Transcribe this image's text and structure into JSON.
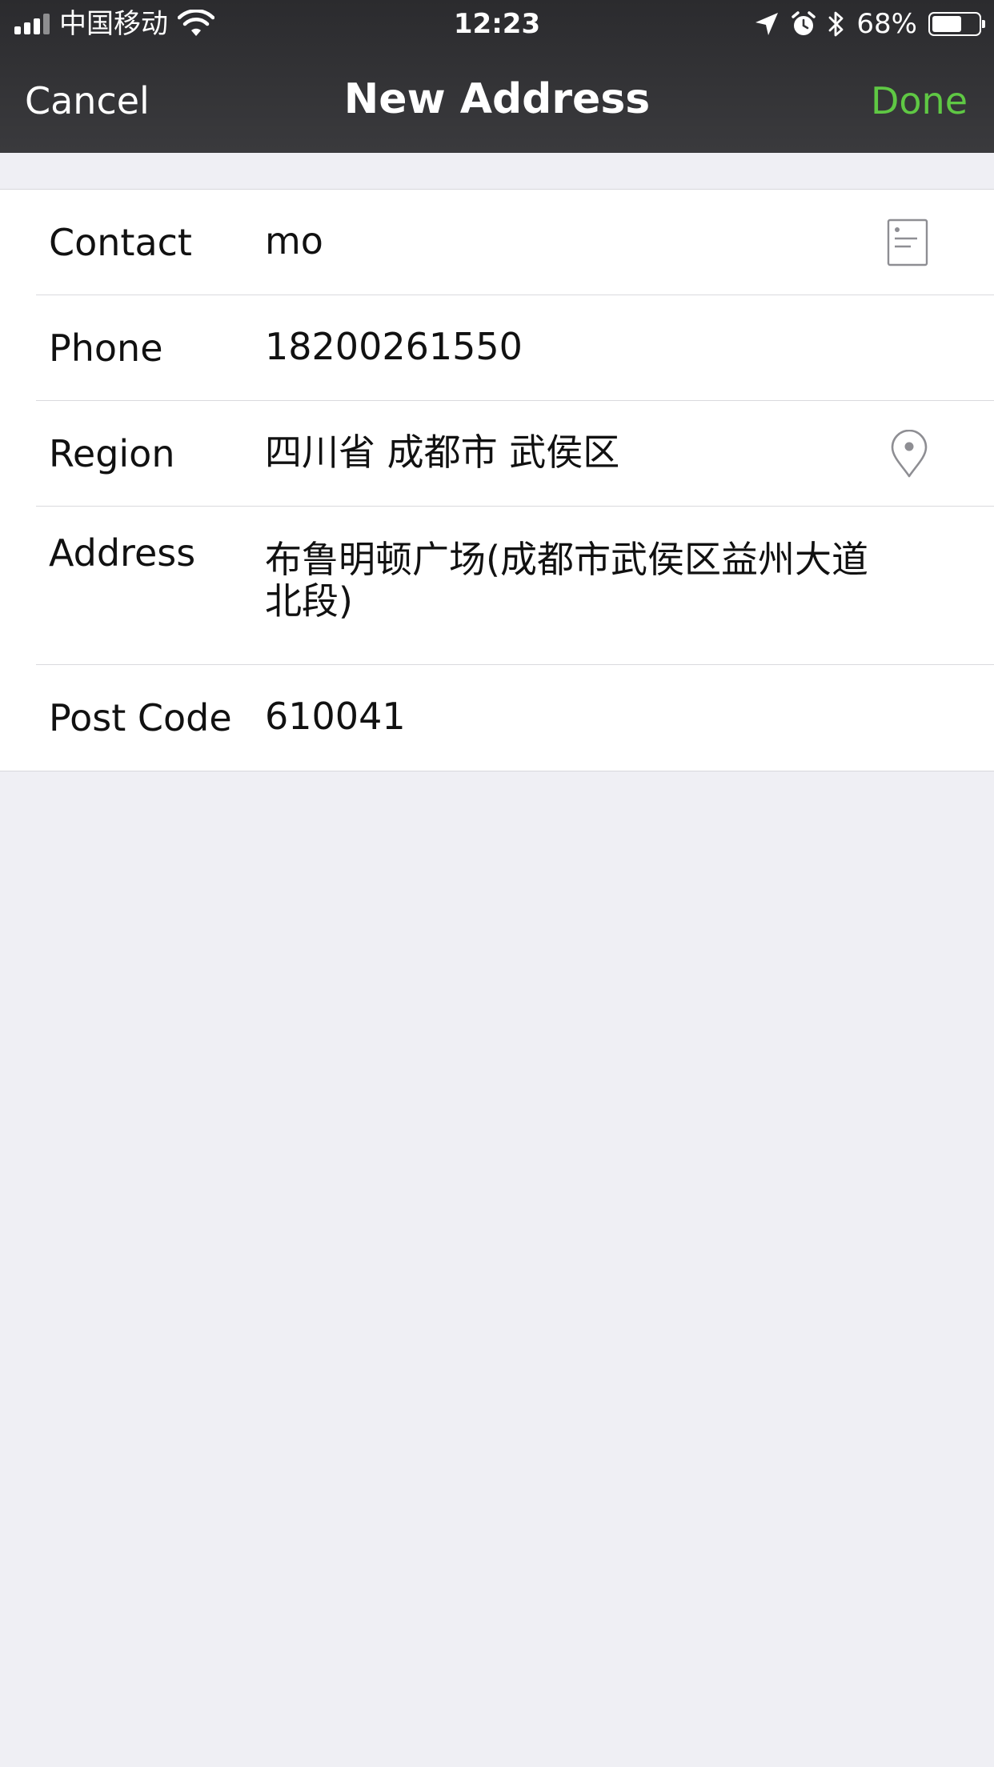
{
  "status_bar": {
    "carrier": "中国移动",
    "time": "12:23",
    "battery_percent": "68%",
    "battery_level": 0.68,
    "icons": [
      "signal-icon",
      "wifi-icon",
      "location-arrow-icon",
      "alarm-icon",
      "bluetooth-icon",
      "battery-icon"
    ]
  },
  "nav": {
    "cancel_label": "Cancel",
    "title": "New Address",
    "done_label": "Done"
  },
  "form": {
    "rows": [
      {
        "label": "Contact",
        "value": "mo",
        "icon": "contact-card-icon"
      },
      {
        "label": "Phone",
        "value": "18200261550"
      },
      {
        "label": "Region",
        "value": "四川省 成都市 武侯区",
        "icon": "location-pin-icon"
      },
      {
        "label": "Address",
        "value": "布鲁明顿广场(成都市武侯区益州大道北段)"
      },
      {
        "label": "Post Code",
        "value": "610041"
      }
    ]
  },
  "colors": {
    "bar_background": "#333336",
    "done_accent": "#5fc844",
    "page_background": "#efeff4"
  }
}
